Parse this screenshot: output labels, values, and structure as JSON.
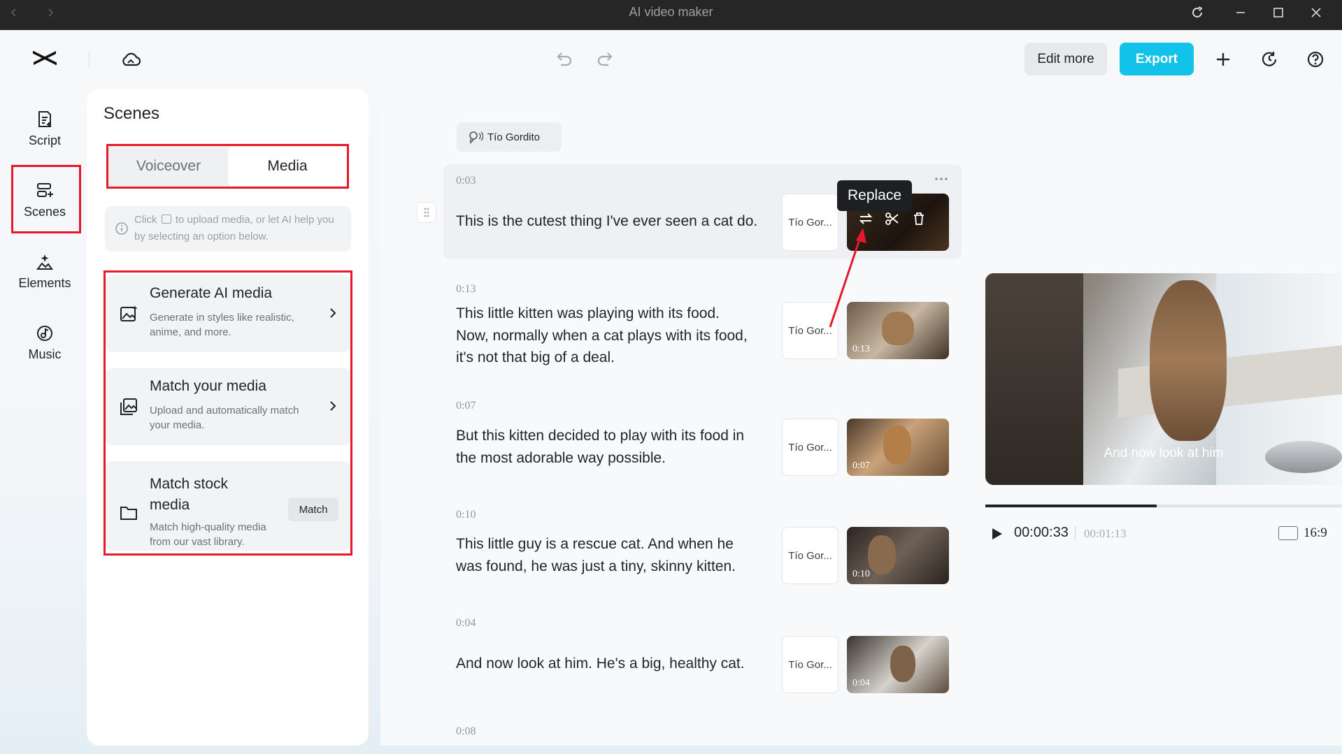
{
  "window": {
    "title": "AI video maker"
  },
  "toolbar": {
    "edit_more": "Edit more",
    "export": "Export"
  },
  "nav": [
    {
      "label": "Script",
      "icon": "script-icon"
    },
    {
      "label": "Scenes",
      "icon": "scenes-icon"
    },
    {
      "label": "Elements",
      "icon": "elements-icon"
    },
    {
      "label": "Music",
      "icon": "music-icon"
    }
  ],
  "scenes_panel": {
    "title": "Scenes",
    "tabs": [
      "Voiceover",
      "Media"
    ],
    "active_tab": "Media",
    "info_line1": "Click",
    "info_line1b": "to upload media, or let AI help you",
    "info_line2": "by selecting an option below.",
    "options": [
      {
        "title": "Generate AI media",
        "desc1": "Generate in styles like realistic,",
        "desc2": "anime, and more."
      },
      {
        "title": "Match your media",
        "desc1": "Upload and automatically match",
        "desc2": "your media."
      },
      {
        "title1": "Match stock",
        "title2": "media",
        "desc1": "Match high-quality media",
        "desc2": "from our vast library.",
        "button": "Match"
      }
    ]
  },
  "voice_chip": "Tío Gordito",
  "tooltip": "Replace",
  "scenes": [
    {
      "time": "0:03",
      "lines": [
        "This is the cutest thing I've ever seen a cat do."
      ],
      "voice": "Tío Gor...",
      "thumb_time": ""
    },
    {
      "time": "0:13",
      "lines": [
        "This little kitten was playing with its food.",
        "Now, normally when a cat plays with its food,",
        "it's not that big of a deal."
      ],
      "voice": "Tío Gor...",
      "thumb_time": "0:13"
    },
    {
      "time": "0:07",
      "lines": [
        "But this kitten decided to play with its food in",
        "the most adorable way possible."
      ],
      "voice": "Tío Gor...",
      "thumb_time": "0:07"
    },
    {
      "time": "0:10",
      "lines": [
        "This little guy is a rescue cat. And when he",
        "was found, he was just a tiny, skinny kitten."
      ],
      "voice": "Tío Gor...",
      "thumb_time": "0:10"
    },
    {
      "time": "0:04",
      "lines": [
        "And now look at him. He's a big, healthy cat."
      ],
      "voice": "Tío Gor...",
      "thumb_time": "0:04"
    },
    {
      "time": "0:08",
      "lines": [],
      "voice": "",
      "thumb_time": ""
    }
  ],
  "preview": {
    "caption": "And now look at him",
    "current_time": "00:00:33",
    "total_time": "00:01:13",
    "progress": 0.48,
    "ratio": "16:9"
  }
}
